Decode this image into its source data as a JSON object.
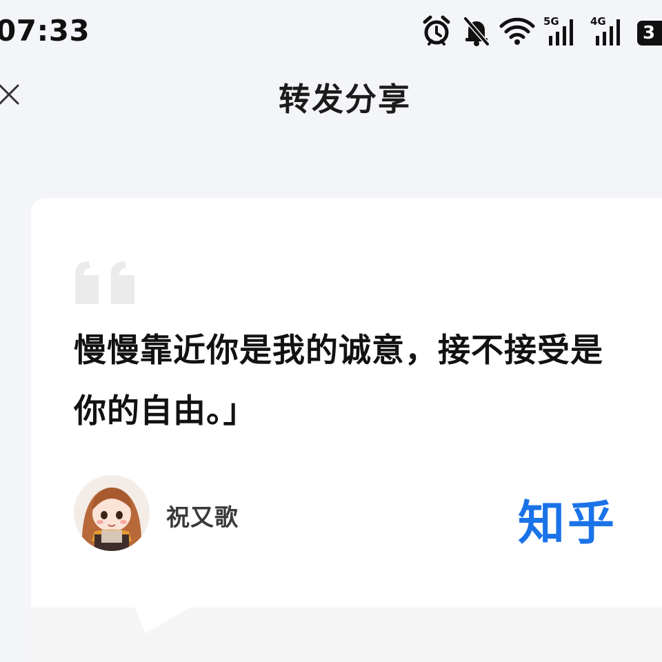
{
  "status_bar": {
    "time": "07:33",
    "network_5g": "5G",
    "network_4g": "4G",
    "battery": "3"
  },
  "header": {
    "title": "转发分享"
  },
  "card": {
    "quote": "慢慢靠近你是我的诚意，接不接受是你的自由。」",
    "author": "祝又歌",
    "brand": "知乎"
  },
  "colors": {
    "brand_blue": "#1a73e8",
    "background": "#f4f5f9",
    "card": "#ffffff"
  },
  "icons": [
    "close-icon",
    "alarm-icon",
    "mute-bell-icon",
    "wifi-icon",
    "signal-icon",
    "battery-icon",
    "quote-icon"
  ]
}
